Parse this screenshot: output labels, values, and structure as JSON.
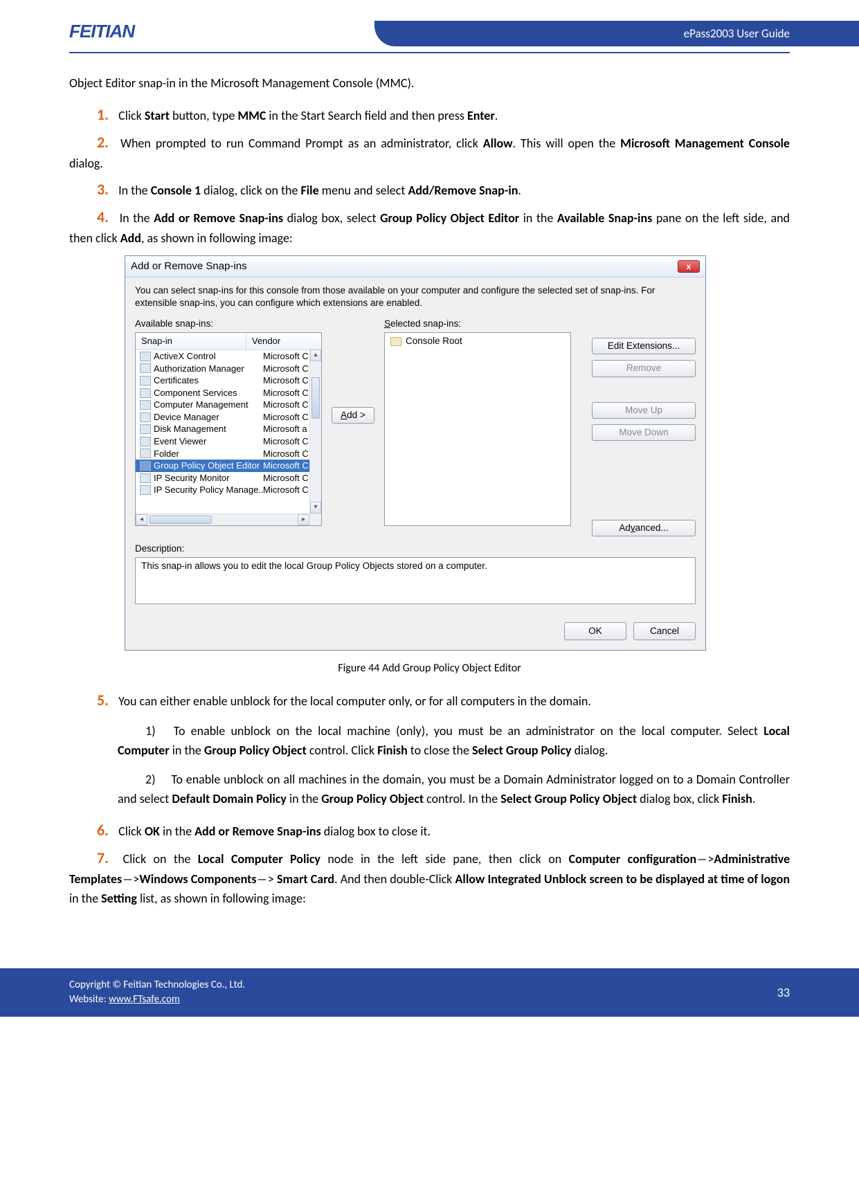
{
  "header": {
    "logo": "FEITIAN",
    "doc_title": "ePass2003  User  Guide"
  },
  "intro": "Object Editor snap-in in the Microsoft Management Console (MMC).",
  "steps": {
    "s1": {
      "num": "1.",
      "pre": "Click ",
      "b1": "Start",
      "mid1": " button, type ",
      "b2": "MMC",
      "mid2": " in the Start Search field and then press ",
      "b3": "Enter",
      "post": "."
    },
    "s2": {
      "num": "2.",
      "pre": "When prompted to run Command Prompt as an administrator, click ",
      "b1": "Allow",
      "mid1": ". This will open the ",
      "b2": "Microsoft Management Console",
      "post": " dialog."
    },
    "s3": {
      "num": "3.",
      "pre": "In the ",
      "b1": "Console 1",
      "mid1": " dialog, click on the ",
      "b2": "File",
      "mid2": " menu and select ",
      "b3": "Add/Remove Snap-in",
      "post": "."
    },
    "s4": {
      "num": "4.",
      "pre": "In the ",
      "b1": "Add or Remove Snap-ins",
      "mid1": " dialog box, select ",
      "b2": "Group Policy Object Editor",
      "mid2": " in the ",
      "b3": "Available Snap-ins",
      "mid3": " pane on the left side, and then click ",
      "b4": "Add",
      "post": ", as shown in following image:"
    },
    "s5": {
      "num": "5.",
      "text": "You can either enable unblock for the local computer only, or for all computers in the domain.",
      "sub1": {
        "num": "1)",
        "pre": "To enable unblock on the local machine (only), you must be an administrator on the local computer. Select ",
        "b1": "Local Computer",
        "mid1": " in the ",
        "b2": "Group Policy Object",
        "mid2": " control. Click ",
        "b3": "Finish",
        "mid3": " to close the ",
        "b4": "Select Group Policy",
        "post": " dialog."
      },
      "sub2": {
        "num": "2)",
        "pre": "To enable unblock on all machines in the domain, you must be a Domain Administrator logged on to a Domain Controller and select ",
        "b1": "Default Domain Policy",
        "mid1": " in the ",
        "b2": "Group Policy Object",
        "mid2": " control. In the ",
        "b3": "Select Group Policy Object",
        "mid3": " dialog box, click ",
        "b4": "Finish",
        "post": "."
      }
    },
    "s6": {
      "num": "6.",
      "pre": "Click ",
      "b1": "OK",
      "mid1": " in the ",
      "b2": "Add or Remove Snap-ins",
      "post": " dialog box to close it."
    },
    "s7": {
      "num": "7.",
      "pre": "Click on the ",
      "b1": "Local Computer Policy",
      "mid1": " node in the left side pane, then click on ",
      "b2": "Computer configuration",
      "arrow1": "―>",
      "b3": "Administrative Templates",
      "arrow2": "―>",
      "b4": "Windows Components",
      "arrow3": "―> ",
      "b5": "Smart Card",
      "mid2": ". And then double-Click ",
      "b6": "Allow Integrated Unblock screen to be displayed at time of logon",
      "mid3": " in the ",
      "b7": "Setting",
      "post": " list, as shown in following image:"
    }
  },
  "figure_caption": "Figure 44 Add Group Policy Object Editor",
  "dialog": {
    "title": "Add or Remove Snap-ins",
    "close": "x",
    "desc": "You can select snap-ins for this console from those available on your computer and configure the selected set of snap-ins. For extensible snap-ins, you can configure which extensions are enabled.",
    "available_label": "Available snap-ins:",
    "selected_label": "Selected snap-ins:",
    "col_snapin": "Snap-in",
    "col_vendor": "Vendor",
    "rows": [
      {
        "name": "ActiveX Control",
        "vendor": "Microsoft C"
      },
      {
        "name": "Authorization Manager",
        "vendor": "Microsoft C"
      },
      {
        "name": "Certificates",
        "vendor": "Microsoft C"
      },
      {
        "name": "Component Services",
        "vendor": "Microsoft C"
      },
      {
        "name": "Computer Management",
        "vendor": "Microsoft C"
      },
      {
        "name": "Device Manager",
        "vendor": "Microsoft C"
      },
      {
        "name": "Disk Management",
        "vendor": "Microsoft a"
      },
      {
        "name": "Event Viewer",
        "vendor": "Microsoft C"
      },
      {
        "name": "Folder",
        "vendor": "Microsoft C"
      },
      {
        "name": "Group Policy Object Editor",
        "vendor": "Microsoft C"
      },
      {
        "name": "IP Security Monitor",
        "vendor": "Microsoft C"
      },
      {
        "name": "IP Security Policy Manage...",
        "vendor": "Microsoft C"
      }
    ],
    "selected_row_index": 9,
    "add_btn": "Add >",
    "selected_item": "Console Root",
    "btn_edit": "Edit Extensions...",
    "btn_remove": "Remove",
    "btn_moveup": "Move Up",
    "btn_movedown": "Move Down",
    "btn_advanced": "Advanced...",
    "desc_label": "Description:",
    "desc_text": "This snap-in allows you to edit the local Group Policy Objects stored on a computer.",
    "btn_ok": "OK",
    "btn_cancel": "Cancel"
  },
  "footer": {
    "copyright": "Copyright © Feitian Technologies Co., Ltd.",
    "website_label": "Website: ",
    "website": "www.FTsafe.com",
    "page_num": "33"
  }
}
